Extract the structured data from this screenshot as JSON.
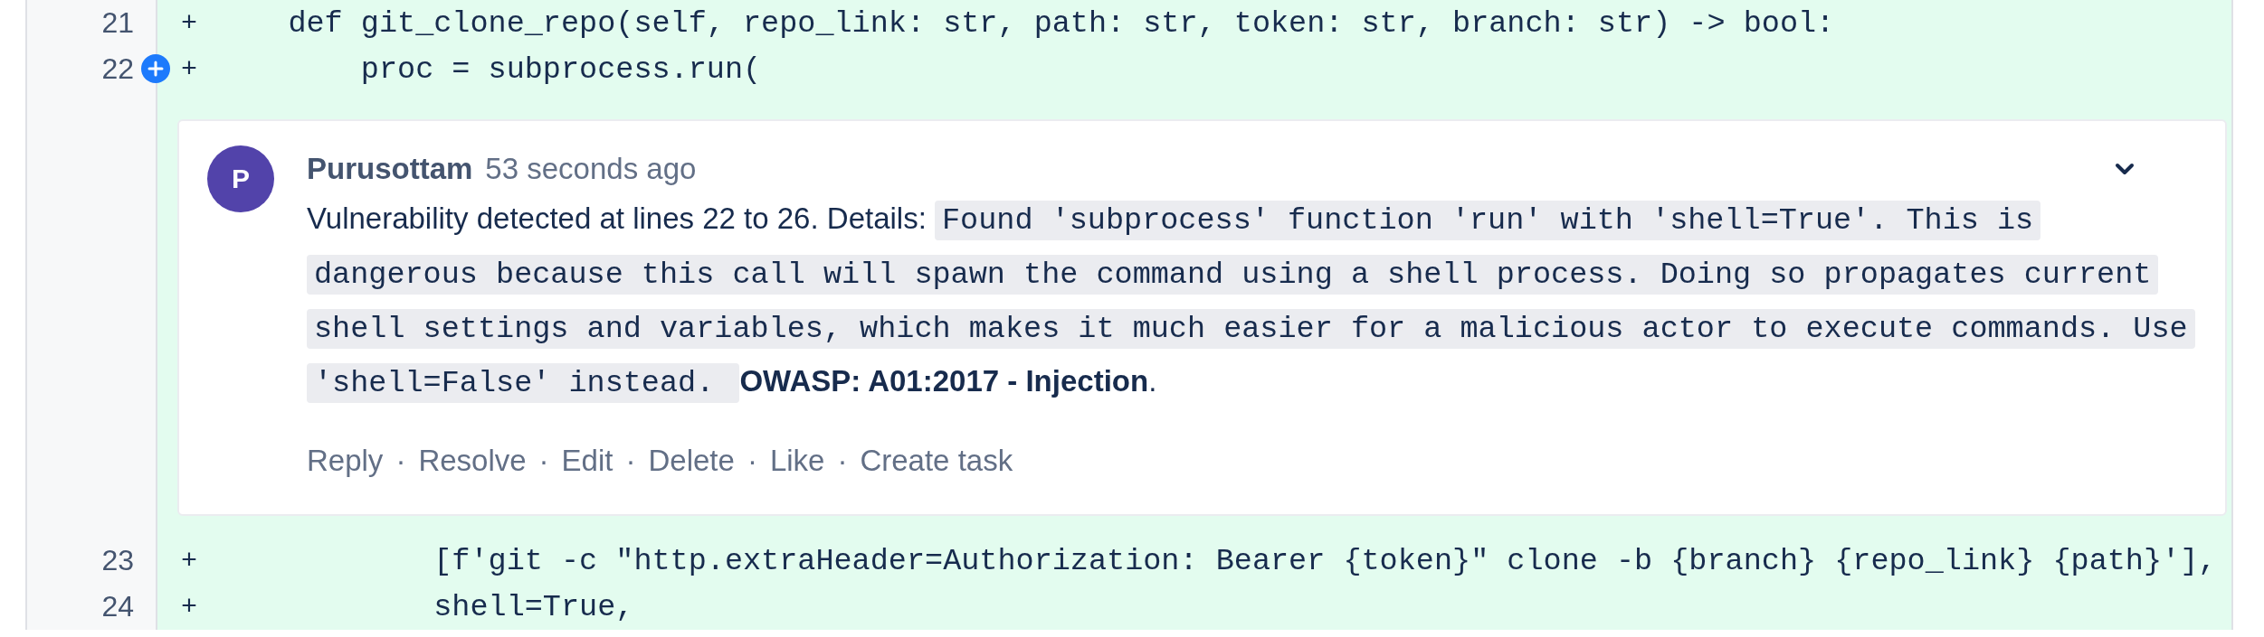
{
  "diff": {
    "lines": [
      {
        "number": "21",
        "sign": "+",
        "code": "    def git_clone_repo(self, repo_link: str, path: str, token: str, branch: str) -> bool:",
        "add_comment_button": false
      },
      {
        "number": "22",
        "sign": "+",
        "code": "        proc = subprocess.run(",
        "add_comment_button": true,
        "comment": {
          "avatar": "P",
          "author": "Purusottam",
          "time": "53 seconds ago",
          "body": [
            {
              "kind": "text",
              "text": "Vulnerability detected at lines 22 to 26. Details: "
            },
            {
              "kind": "code",
              "text": "Found 'subprocess' function 'run' with 'shell=True'. This is dangerous because this call will spawn the command using a shell process. Doing so propagates current shell settings and variables, which makes it much easier for a malicious actor to execute commands. Use 'shell=False' instead. "
            },
            {
              "kind": "bold",
              "text": "OWASP: A01:2017 - Injection"
            },
            {
              "kind": "text",
              "text": "."
            }
          ],
          "actions": [
            "Reply",
            "Resolve",
            "Edit",
            "Delete",
            "Like",
            "Create task"
          ],
          "separator": "·"
        }
      },
      {
        "number": "23",
        "sign": "+",
        "code": "            [f'git -c \"http.extraHeader=Authorization: Bearer {token}\" clone -b {branch} {repo_link} {path}'],",
        "add_comment_button": false
      },
      {
        "number": "24",
        "sign": "+",
        "code": "            shell=True,",
        "add_comment_button": false
      }
    ]
  }
}
